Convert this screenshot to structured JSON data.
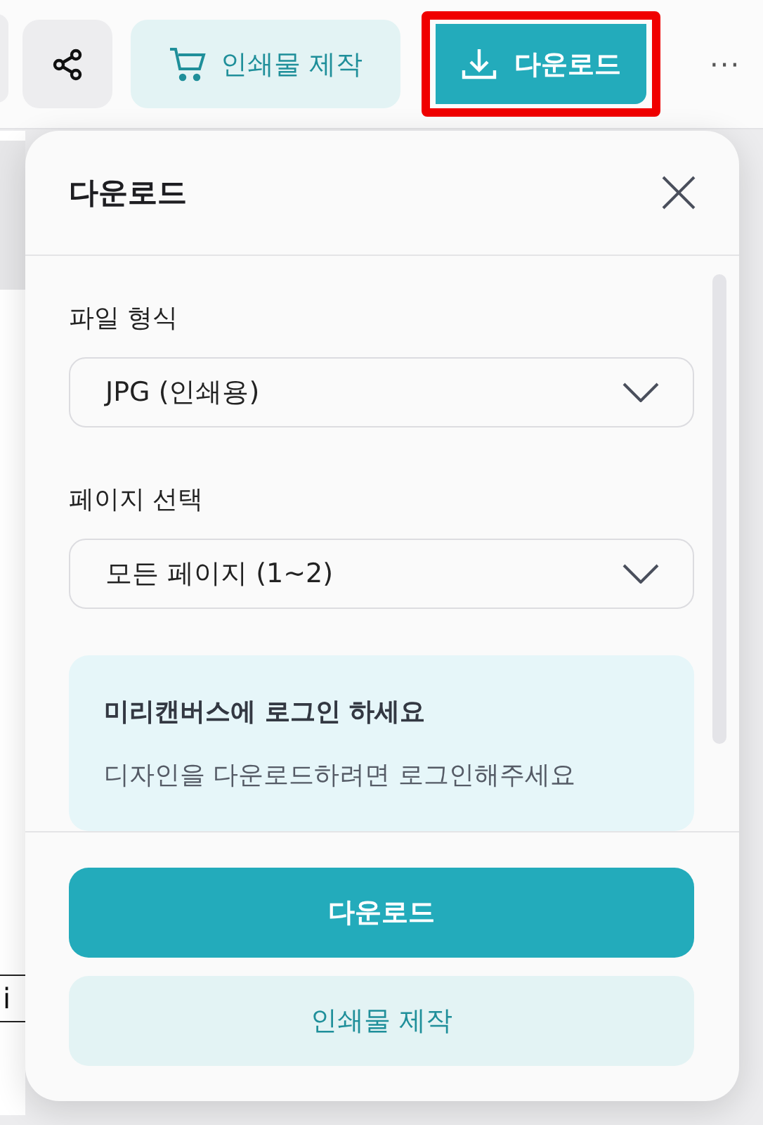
{
  "toolbar": {
    "buttons": [
      {
        "kind": "share"
      },
      {
        "kind": "print",
        "label": "인쇄물 제작"
      },
      {
        "kind": "download",
        "label": "다운로드",
        "highlighted": true
      },
      {
        "kind": "more",
        "label": "···"
      }
    ]
  },
  "background": {
    "fragment": "i"
  },
  "download_panel": {
    "title": "다운로드",
    "fields": [
      {
        "label": "파일 형식",
        "value": "JPG (인쇄용)"
      },
      {
        "label": "페이지 선택",
        "value": "모든 페이지 (1~2)"
      }
    ],
    "notice": {
      "title": "미리캔버스에 로그인 하세요",
      "text": "디자인을 다운로드하려면 로그인해주세요"
    },
    "buttons": [
      {
        "kind": "primary",
        "label": "다운로드"
      },
      {
        "kind": "secondary",
        "label": "인쇄물 제작"
      }
    ]
  }
}
